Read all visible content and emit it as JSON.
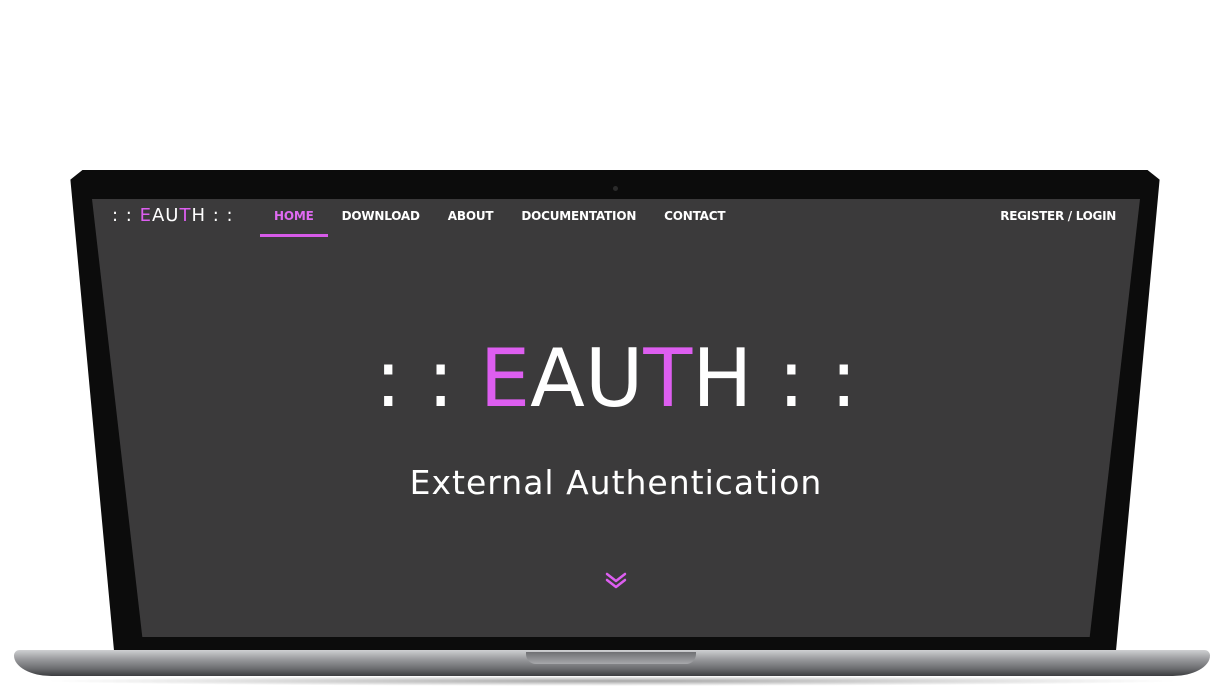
{
  "nav": {
    "logo_prefix": ": : ",
    "logo_e": "E",
    "logo_au": "AU",
    "logo_t": "T",
    "logo_h": "H",
    "logo_suffix": " : :",
    "items": [
      {
        "label": "HOME",
        "active": true
      },
      {
        "label": "DOWNLOAD",
        "active": false
      },
      {
        "label": "ABOUT",
        "active": false
      },
      {
        "label": "DOCUMENTATION",
        "active": false
      },
      {
        "label": "CONTACT",
        "active": false
      }
    ],
    "register_label": "REGISTER / LOGIN"
  },
  "hero": {
    "title_prefix": ": : ",
    "title_e": "E",
    "title_au": "AU",
    "title_t": "T",
    "title_h": "H",
    "title_suffix": " : :",
    "subtitle": "External Authentication",
    "scroll_icon": "double-chevron-down-icon"
  },
  "colors": {
    "accent": "#dd5ef0",
    "screen_bg": "#3b3a3b",
    "text": "#ffffff"
  }
}
